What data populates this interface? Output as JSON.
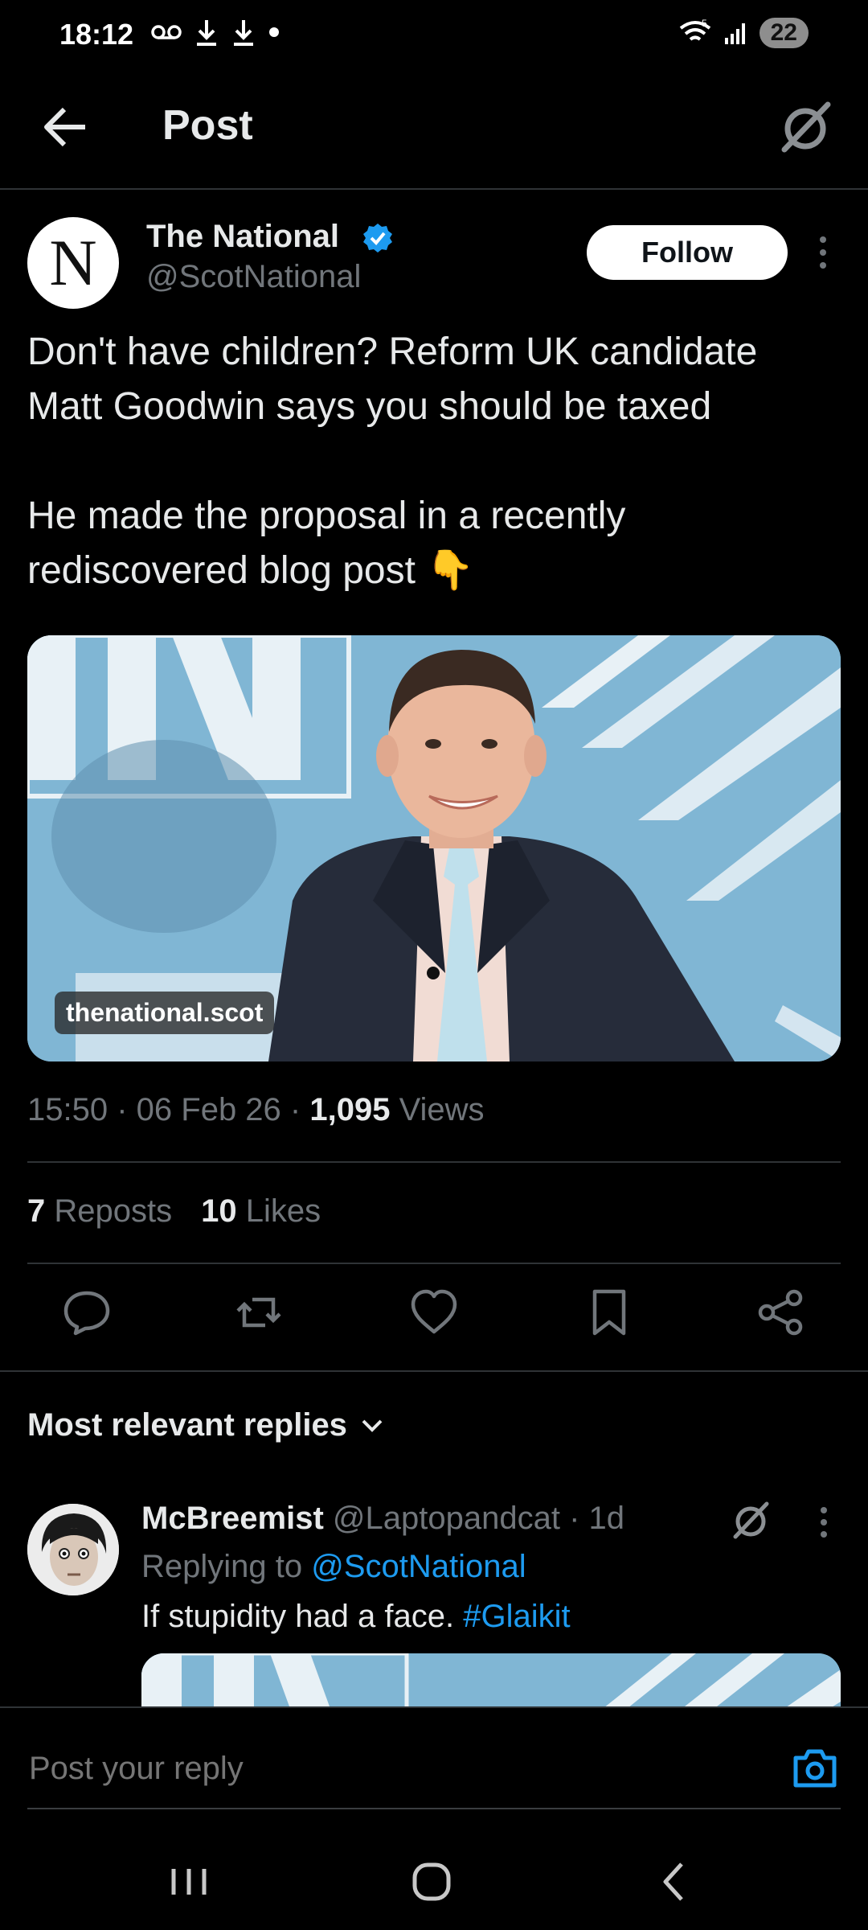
{
  "status_bar": {
    "time": "18:12",
    "left_icons": [
      "voicemail-icon",
      "download-icon",
      "download-icon",
      "dot-icon"
    ],
    "signal_label": "5",
    "battery": "22"
  },
  "header": {
    "title": "Post",
    "back_icon": "arrow-left-icon",
    "grok_icon": "grok-icon"
  },
  "post": {
    "author_name": "The National",
    "author_handle": "@ScotNational",
    "avatar_letter": "N",
    "verified": true,
    "follow_label": "Follow",
    "text": "Don't have children? Reform UK candidate Matt Goodwin says you should be taxed\n\nHe made the proposal in a recently rediscovered blog post 👇",
    "media": {
      "domain": "thenational.scot"
    },
    "time": "15:50",
    "date": "06 Feb 26",
    "views_count": "1,095",
    "views_label": "Views",
    "reposts_count": "7",
    "reposts_label": "Reposts",
    "likes_count": "10",
    "likes_label": "Likes"
  },
  "actions": [
    "reply-icon",
    "repost-icon",
    "like-icon",
    "bookmark-icon",
    "share-icon"
  ],
  "replies": {
    "sort_label": "Most relevant replies",
    "items": [
      {
        "name": "McBreemist",
        "handle": "@Laptopandcat",
        "sep": "·",
        "age": "1d",
        "replying_prefix": "Replying to",
        "replying_to": "@ScotNational",
        "text": "If stupidity had a face.",
        "hashtag": "#Glaikit"
      }
    ]
  },
  "composer": {
    "placeholder": "Post your reply"
  },
  "colors": {
    "background": "#000000",
    "text": "#e7e9ea",
    "muted": "#71767b",
    "accent": "#1d9bf0",
    "divider": "#2f3336"
  }
}
